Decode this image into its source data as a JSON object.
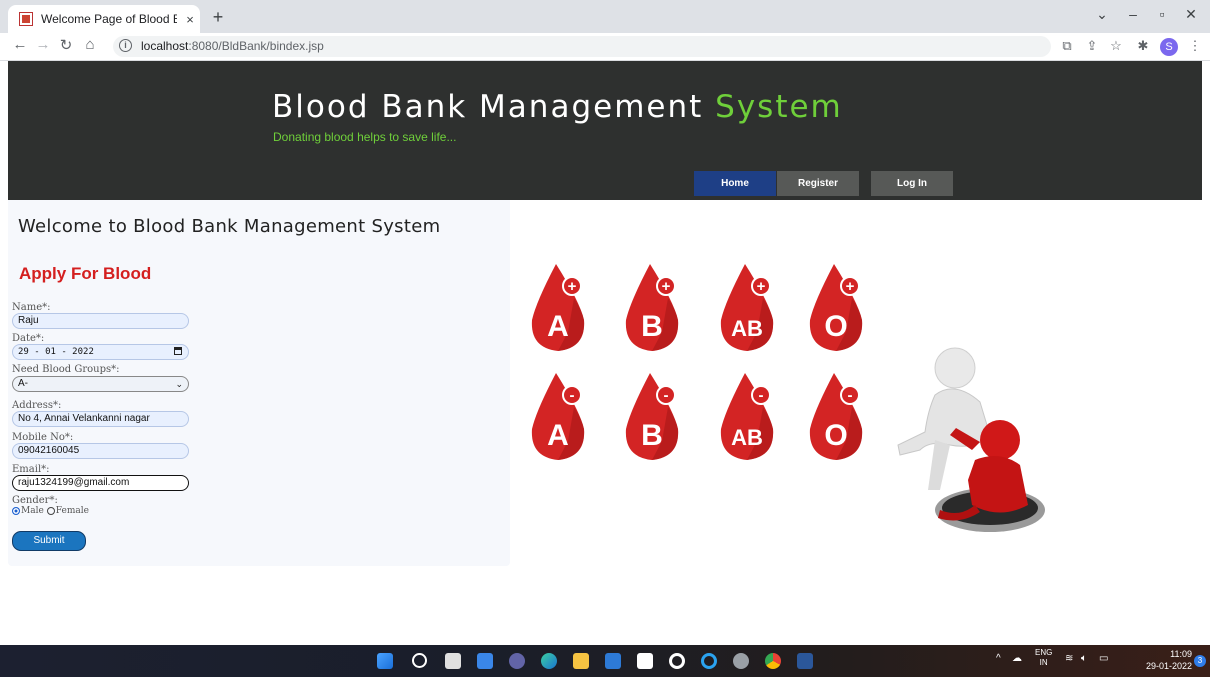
{
  "browser": {
    "tab_title": "Welcome Page of Blood Bank M",
    "tab_close": "×",
    "new_tab": "+",
    "url_host": "localhost",
    "url_path": ":8080/BldBank/bindex.jsp",
    "profile_initial": "S"
  },
  "header": {
    "title_main": "Blood Bank Management",
    "title_accent": "System",
    "tagline": "Donating blood helps to save life...",
    "nav": [
      "Home",
      "Register",
      "Log In"
    ]
  },
  "panel": {
    "welcome": "Welcome to Blood Bank Management System",
    "form_title": "Apply For Blood",
    "name_label": "Name*:",
    "name_value": "Raju",
    "date_label": "Date*:",
    "date_value": "29 - 01 - 2022",
    "blood_label": "Need Blood Groups*:",
    "blood_value": "A-",
    "address_label": "Address*:",
    "address_value": "No 4, Annai Velankanni nagar",
    "mobile_label": "Mobile No*:",
    "mobile_value": "09042160045",
    "email_label": "Email*:",
    "email_value": "raju1324199@gmail.com",
    "gender_label": "Gender*:",
    "gender_options": [
      "Male",
      "Female"
    ],
    "gender_selected": "Male",
    "submit": "Submit"
  },
  "blood_groups": [
    {
      "type": "A",
      "sign": "+"
    },
    {
      "type": "B",
      "sign": "+"
    },
    {
      "type": "AB",
      "sign": "+"
    },
    {
      "type": "O",
      "sign": "+"
    },
    {
      "type": "A",
      "sign": "-"
    },
    {
      "type": "B",
      "sign": "-"
    },
    {
      "type": "AB",
      "sign": "-"
    },
    {
      "type": "O",
      "sign": "-"
    }
  ],
  "colors": {
    "header_bg": "#2e302f",
    "accent_green": "#6fcf3a",
    "title_red": "#d41f1f",
    "home_blue": "#1e3f86",
    "drop_red": "#d32424",
    "submit_blue": "#1b75bf"
  },
  "taskbar": {
    "lang_top": "ENG",
    "lang_bottom": "IN",
    "time": "11:09",
    "date": "29-01-2022",
    "notifications": "3"
  }
}
